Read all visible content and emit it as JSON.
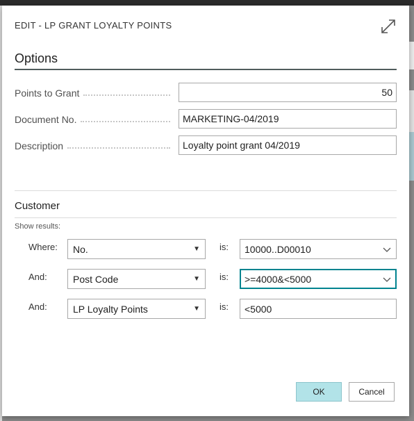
{
  "dialog": {
    "title": "EDIT - LP GRANT LOYALTY POINTS",
    "expand_icon": "expand-icon"
  },
  "options": {
    "heading": "Options",
    "fields": [
      {
        "label": "Points to Grant",
        "value": "50"
      },
      {
        "label": "Document No.",
        "value": "MARKETING-04/2019"
      },
      {
        "label": "Description",
        "value": "Loyalty point grant 04/2019"
      }
    ]
  },
  "customer": {
    "heading": "Customer",
    "show_results": "Show results:",
    "filters": [
      {
        "label": "Where:",
        "field": "No.",
        "is": "is:",
        "value": "10000..D00010"
      },
      {
        "label": "And:",
        "field": "Post Code",
        "is": "is:",
        "value": ">=4000&<5000"
      },
      {
        "label": "And:",
        "field": "LP Loyalty Points",
        "is": "is:",
        "value": "<5000"
      }
    ]
  },
  "buttons": {
    "ok": "OK",
    "cancel": "Cancel"
  },
  "colors": {
    "accent": "#00838f",
    "ok_button": "#b2e3e8"
  }
}
